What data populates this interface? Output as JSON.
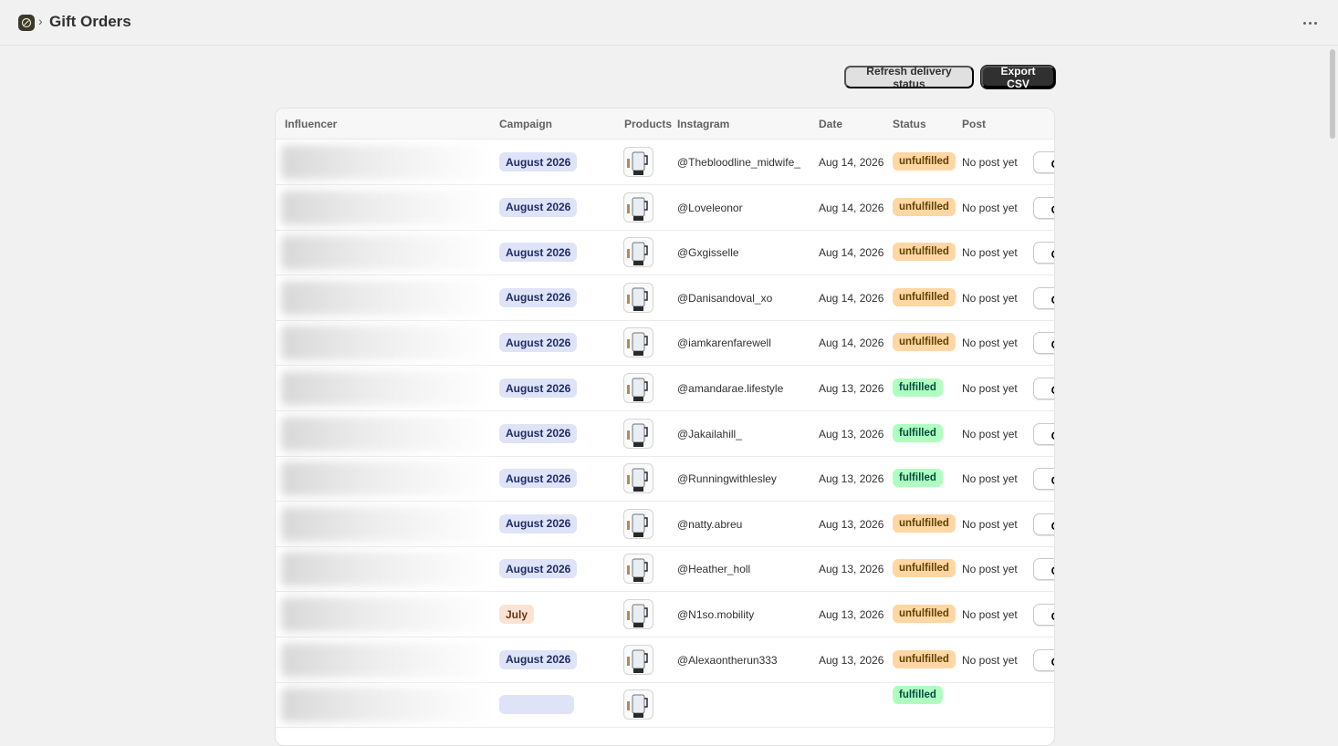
{
  "header": {
    "title": "Gift Orders",
    "breadcrumb_separator": "›",
    "app_icon": "app-logo-icon",
    "more_icon": "more-horizontal-icon"
  },
  "actions": {
    "refresh_label": "Refresh delivery status",
    "export_label": "Export CSV"
  },
  "table": {
    "columns": [
      "Influencer",
      "Campaign",
      "Products",
      "Instagram",
      "Date",
      "Status",
      "Post"
    ],
    "rows": [
      {
        "campaign": "August 2026",
        "campaign_color": "blue",
        "instagram": "@Thebloodline_midwife_",
        "date": "Aug 14, 2026",
        "status": "unfulfilled",
        "post": "No post yet",
        "action": "Gift"
      },
      {
        "campaign": "August 2026",
        "campaign_color": "blue",
        "instagram": "@Loveleonor",
        "date": "Aug 14, 2026",
        "status": "unfulfilled",
        "post": "No post yet",
        "action": "Gift"
      },
      {
        "campaign": "August 2026",
        "campaign_color": "blue",
        "instagram": "@Gxgisselle",
        "date": "Aug 14, 2026",
        "status": "unfulfilled",
        "post": "No post yet",
        "action": "Gift"
      },
      {
        "campaign": "August 2026",
        "campaign_color": "blue",
        "instagram": "@Danisandoval_xo",
        "date": "Aug 14, 2026",
        "status": "unfulfilled",
        "post": "No post yet",
        "action": "Gift"
      },
      {
        "campaign": "August 2026",
        "campaign_color": "blue",
        "instagram": "@iamkarenfarewell",
        "date": "Aug 14, 2026",
        "status": "unfulfilled",
        "post": "No post yet",
        "action": "Gift"
      },
      {
        "campaign": "August 2026",
        "campaign_color": "blue",
        "instagram": "@amandarae.lifestyle",
        "date": "Aug 13, 2026",
        "status": "fulfilled",
        "post": "No post yet",
        "action": "Gift"
      },
      {
        "campaign": "August 2026",
        "campaign_color": "blue",
        "instagram": "@Jakailahill_",
        "date": "Aug 13, 2026",
        "status": "fulfilled",
        "post": "No post yet",
        "action": "Gift"
      },
      {
        "campaign": "August 2026",
        "campaign_color": "blue",
        "instagram": "@Runningwithlesley",
        "date": "Aug 13, 2026",
        "status": "fulfilled",
        "post": "No post yet",
        "action": "Gift"
      },
      {
        "campaign": "August 2026",
        "campaign_color": "blue",
        "instagram": "@natty.abreu",
        "date": "Aug 13, 2026",
        "status": "unfulfilled",
        "post": "No post yet",
        "action": "Gift"
      },
      {
        "campaign": "August 2026",
        "campaign_color": "blue",
        "instagram": "@Heather_holl",
        "date": "Aug 13, 2026",
        "status": "unfulfilled",
        "post": "No post yet",
        "action": "Gift"
      },
      {
        "campaign": "July",
        "campaign_color": "peach",
        "instagram": "@N1so.mobility",
        "date": "Aug 13, 2026",
        "status": "unfulfilled",
        "post": "No post yet",
        "action": "Gift"
      },
      {
        "campaign": "August 2026",
        "campaign_color": "blue",
        "instagram": "@Alexaontherun333",
        "date": "Aug 13, 2026",
        "status": "unfulfilled",
        "post": "No post yet",
        "action": "Gift"
      },
      {
        "campaign": "",
        "campaign_color": "blue",
        "instagram": "",
        "date": "",
        "status": "fulfilled",
        "post": "",
        "action": ""
      }
    ]
  },
  "colors": {
    "background": "#f1f1f1",
    "campaign_blue": "#dfe3f8",
    "campaign_peach": "#fbe3d3",
    "status_unfulfilled": "#ffd6a4",
    "status_fulfilled": "#affebf",
    "primary_button": "#303030"
  }
}
